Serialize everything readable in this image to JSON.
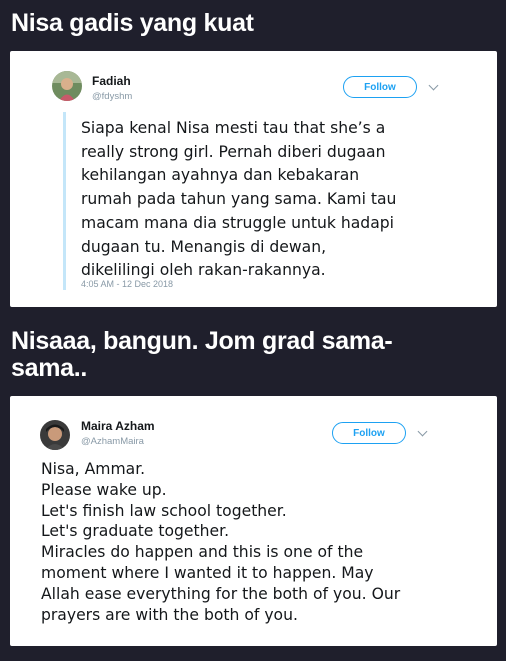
{
  "sections": [
    {
      "title": "Nisa gadis yang kuat",
      "tweet": {
        "name": "Fadiah",
        "handle": "@fdyshm",
        "follow_label": "Follow",
        "text": "Siapa kenal Nisa mesti tau that she’s a\nreally strong girl. Pernah diberi dugaan\nkehilangan ayahnya dan kebakaran\nrumah pada tahun yang sama. Kami tau\nmacam mana dia struggle untuk hadapi\ndugaan tu. Menangis di dewan,\ndikelilingi oleh rakan-rakannya.",
        "timestamp": "4:05 AM - 12 Dec 2018"
      }
    },
    {
      "title": "Nisaaa, bangun. Jom grad sama-\nsama..",
      "tweet": {
        "name": "Maira Azham",
        "handle": "@AzhamMaira",
        "follow_label": "Follow",
        "text": "Nisa, Ammar.\nPlease wake up.\nLet's finish law school together.\nLet's graduate together.\nMiracles do happen and this is one of the\nmoment where I wanted it to happen. May\nAllah ease everything for the both of you. Our\nprayers are with the both of you."
      }
    }
  ],
  "colors": {
    "background": "#1f1f2c",
    "accent": "#1da1f2",
    "secondary_text": "#8899a6"
  },
  "icons": [
    "avatar-photo",
    "chevron-down-icon"
  ]
}
